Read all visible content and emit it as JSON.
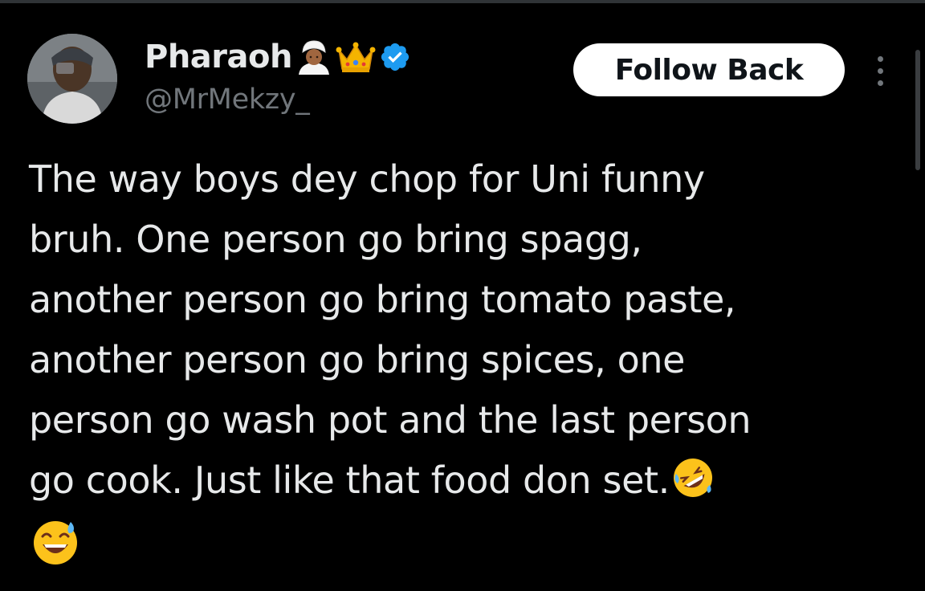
{
  "author": {
    "display_name": "Pharaoh",
    "handle": "@MrMekzy_",
    "name_emojis": [
      "person-with-turban-emoji",
      "crown-emoji"
    ],
    "verified": true,
    "verified_color": "#1d9bf0"
  },
  "actions": {
    "follow_label": "Follow Back",
    "more_icon": "more-vertical-icon"
  },
  "tweet": {
    "lines": [
      "The way boys dey chop for Uni funny",
      "bruh. One person go bring spagg,",
      "another person go bring tomato paste,",
      "another person go bring spices, one",
      "person go wash pot and the last person",
      "go cook. Just like that food don set."
    ],
    "trailing_emojis": [
      "rolling-on-floor-laughing-emoji",
      "grinning-sweat-emoji"
    ]
  },
  "colors": {
    "background": "#000000",
    "text": "#e7e9ea",
    "muted": "#71767b",
    "button_bg": "#ffffff",
    "button_text": "#0f1419"
  }
}
